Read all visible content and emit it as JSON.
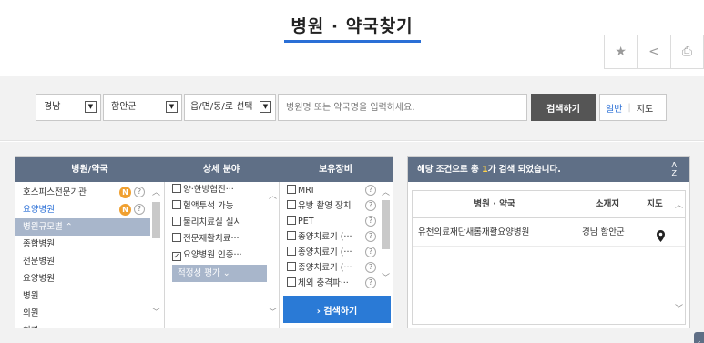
{
  "page": {
    "title": "병원 · 약국찾기"
  },
  "utility": {
    "favorite_icon": "★",
    "share_icon": "<",
    "print_icon": "⎙"
  },
  "search": {
    "sido": "경남",
    "gungu": "함안군",
    "dong": "읍/면/동/로 선택",
    "keyword_placeholder": "병원명 또는 약국명을 입력하세요.",
    "search_button": "검색하기",
    "view_general": "일반",
    "view_map": "지도"
  },
  "filters": {
    "headers": {
      "type": "병원/약국",
      "detail": "상세 분야",
      "equipment": "보유장비"
    },
    "types": [
      {
        "label": "호스피스전문기관",
        "badge": "N",
        "help": "?"
      },
      {
        "label": "요양병원",
        "badge": "N",
        "help": "?",
        "selected": true
      },
      {
        "label": "병원규모별 ⌃",
        "group": true
      },
      {
        "label": "종합병원"
      },
      {
        "label": "전문병원"
      },
      {
        "label": "요양병원"
      },
      {
        "label": "병원"
      },
      {
        "label": "의원"
      },
      {
        "label": "치과"
      }
    ],
    "details": [
      {
        "label": "양·한방협진···",
        "checked": false
      },
      {
        "label": "혈액투석 가능",
        "checked": false
      },
      {
        "label": "물리치료실 실시",
        "checked": false
      },
      {
        "label": "전문재활치료···",
        "checked": false
      },
      {
        "label": "요양병원 인증···",
        "checked": true
      }
    ],
    "detail_group": "적정성 평가 ⌄",
    "equipment": [
      {
        "label": "MRI",
        "help": "?"
      },
      {
        "label": "유방 촬영 장치",
        "help": "?"
      },
      {
        "label": "PET",
        "help": "?"
      },
      {
        "label": "종양치료기 (···",
        "help": "?"
      },
      {
        "label": "종양치료기 (···",
        "help": "?"
      },
      {
        "label": "종양치료기 (···",
        "help": "?"
      },
      {
        "label": "체외 충격파···",
        "help": "?"
      }
    ],
    "search_button": "› 검색하기"
  },
  "results": {
    "summary_prefix": "해당 조건으로 총 ",
    "count": "1",
    "summary_suffix": "가 검색 되었습니다.",
    "sort_label_top": "A",
    "sort_label_bottom": "Z",
    "columns": {
      "name": "병원 · 약국",
      "location": "소재지",
      "map": "지도"
    },
    "rows": [
      {
        "name": "유천의료재단새롬재활요양병원",
        "location": "경남 함안군",
        "map_icon": "location-pin"
      }
    ]
  }
}
